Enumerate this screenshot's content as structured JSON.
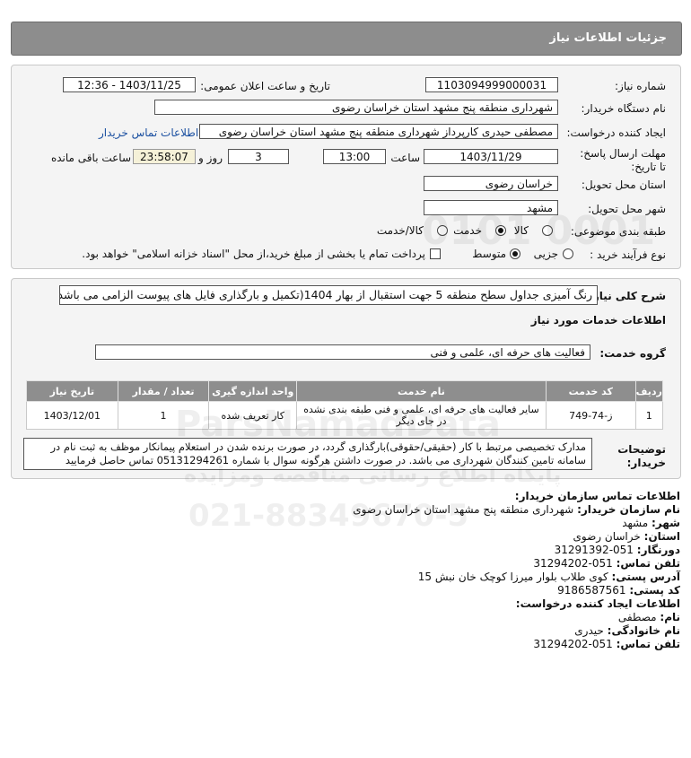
{
  "header": {
    "title": "جزئیات اطلاعات نیاز"
  },
  "form": {
    "need_number_label": "شماره نیاز:",
    "need_number": "1103094999000031",
    "announce_label": "تاریخ و ساعت اعلان عمومی:",
    "announce_value": "1403/11/25 - 12:36",
    "buyer_label": "نام دستگاه خریدار:",
    "buyer_value": "شهرداری منطقه پنج مشهد استان خراسان رضوی",
    "creator_label": "ایجاد کننده درخواست:",
    "creator_value": "مصطفی حیدری کارپرداز شهرداری منطقه پنج مشهد استان خراسان رضوی",
    "contact_link": "اطلاعات تماس خریدار",
    "deadline_label": "مهلت ارسال پاسخ: تا تاریخ:",
    "deadline_date": "1403/11/29",
    "time_label": "ساعت",
    "deadline_time": "13:00",
    "days_value": "3",
    "days_label": "روز و",
    "remaining_value": "23:58:07",
    "remaining_label": "ساعت باقی مانده",
    "province_label": "استان محل تحویل:",
    "province_value": "خراسان رضوی",
    "city_label": "شهر محل تحویل:",
    "city_value": "مشهد",
    "category_label": "طبقه بندی موضوعی:",
    "category_options": [
      "کالا",
      "خدمت",
      "کالا/خدمت"
    ],
    "process_label": "نوع فرآیند خرید :",
    "process_options": [
      "جزیی",
      "متوسط"
    ],
    "payment_text": "پرداخت تمام یا بخشی از مبلغ خرید،از محل \"اسناد خزانه اسلامی\" خواهد بود."
  },
  "details": {
    "summary_label": "شرح کلی نیاز:",
    "summary_value": "رنگ آمیزی جداول سطح منطقه 5 جهت استقبال از بهار 1404(تکمیل و بارگذاری فایل های پیوست الزامی می باشد)",
    "services_heading": "اطلاعات خدمات مورد نیاز",
    "group_label": "گروه خدمت:",
    "group_value": "فعالیت های حرفه ای، علمی و فنی",
    "table": {
      "headers": [
        "ردیف",
        "کد خدمت",
        "نام خدمت",
        "واحد اندازه گیری",
        "تعداد / مقدار",
        "تاریخ نیاز"
      ],
      "rows": [
        [
          "1",
          "ز-74-749",
          "سایر فعالیت های حرفه ای، علمی و فنی طبقه بندی نشده در جای دیگر",
          "کار تعریف شده",
          "1",
          "1403/12/01"
        ]
      ]
    },
    "notes_label": "توضیحات خریدار:",
    "notes_value": "مدارک تخصیصی مرتبط با کار (حقیقی/حقوقی)بارگذاری گردد، در صورت برنده شدن در استعلام پیمانکار موظف به ثبت نام در سامانه تامین کنندگان شهرداری می باشد. در صورت داشتن هرگونه سوال با شماره 05131294261 تماس حاصل فرمایید"
  },
  "contact": {
    "org_heading": "اطلاعات تماس سازمان خریدار:",
    "org_name_label": "نام سازمان خریدار:",
    "org_name": "شهرداری منطقه پنج مشهد استان خراسان رضوی",
    "city_label": "شهر:",
    "city": "مشهد",
    "province_label": "استان:",
    "province": "خراسان رضوی",
    "fax_label": "دورنگار:",
    "fax": "051-31291392",
    "phone_label": "تلفن تماس:",
    "phone": "051-31294202",
    "address_label": "آدرس پستی:",
    "address": "کوی طلاب بلوار میرزا کوچک خان نبش 15",
    "postal_label": "کد پستی:",
    "postal": "9186587561",
    "creator_heading": "اطلاعات ایجاد کننده درخواست:",
    "first_name_label": "نام:",
    "first_name": "مصطفی",
    "last_name_label": "نام خانوادگی:",
    "last_name": "حیدری",
    "creator_phone_label": "تلفن تماس:",
    "creator_phone": "051-31294202"
  },
  "watermark": {
    "brand": "ParsNamadData",
    "slogan": "پایگاه اطلاع رسانی مناقصه ومزایده",
    "phone": "021-88349670-5",
    "digits": "0101 0001"
  }
}
